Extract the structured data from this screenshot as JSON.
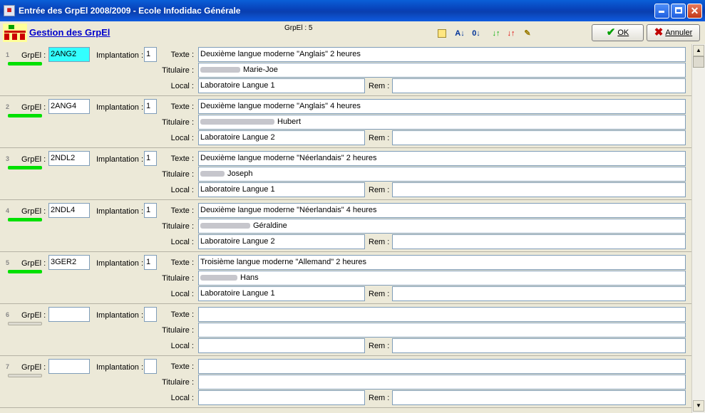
{
  "window": {
    "title": "Entrée des GrpEl 2008/2009  -  Ecole Infodidac Générale"
  },
  "header": {
    "title": "Gestion des GrpEl",
    "count": "GrpEl : 5",
    "ok_label": "OK",
    "cancel_label": "Annuler"
  },
  "labels": {
    "grpel": "GrpEl :",
    "implantation": "Implantation :",
    "texte": "Texte :",
    "titulaire": "Titulaire :",
    "local": "Local :",
    "rem": "Rem :"
  },
  "records": [
    {
      "num": "1",
      "code": "2ANG2",
      "implantation": "1",
      "texte": "Deuxième langue moderne \"Anglais\" 2 heures",
      "titulaire": "Marie-Joe",
      "local": "Laboratoire Langue 1",
      "rem": ""
    },
    {
      "num": "2",
      "code": "2ANG4",
      "implantation": "1",
      "texte": "Deuxième langue moderne \"Anglais\" 4 heures",
      "titulaire": "Hubert",
      "local": "Laboratoire Langue 2",
      "rem": ""
    },
    {
      "num": "3",
      "code": "2NDL2",
      "implantation": "1",
      "texte": "Deuxième langue moderne \"Néerlandais\" 2 heures",
      "titulaire": "Joseph",
      "local": "Laboratoire Langue 1",
      "rem": ""
    },
    {
      "num": "4",
      "code": "2NDL4",
      "implantation": "1",
      "texte": "Deuxième langue moderne \"Néerlandais\" 4 heures",
      "titulaire": "Géraldine",
      "local": "Laboratoire Langue 2",
      "rem": ""
    },
    {
      "num": "5",
      "code": "3GER2",
      "implantation": "1",
      "texte": "Troisième langue moderne \"Allemand\" 2 heures",
      "titulaire": "Hans",
      "local": "Laboratoire Langue 1",
      "rem": ""
    },
    {
      "num": "6",
      "code": "",
      "implantation": "",
      "texte": "",
      "titulaire": "",
      "local": "",
      "rem": ""
    },
    {
      "num": "7",
      "code": "",
      "implantation": "",
      "texte": "",
      "titulaire": "",
      "local": "",
      "rem": ""
    }
  ],
  "colors": {
    "selected_field": "#33ffff",
    "status_active": "#00e000",
    "titlebar": "#0a3fae"
  }
}
